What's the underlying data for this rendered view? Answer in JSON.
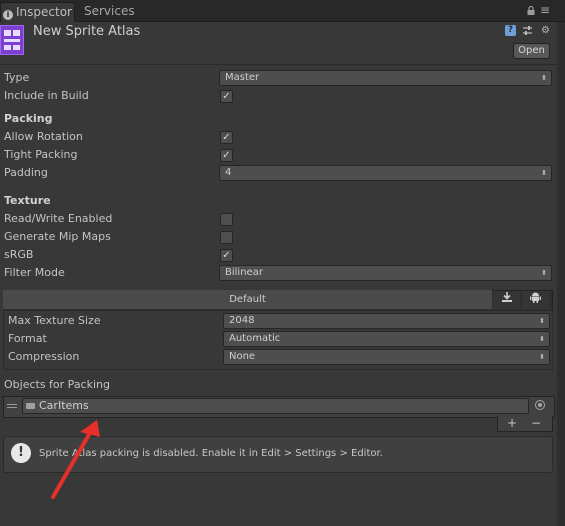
{
  "tabs": [
    {
      "label": "Inspector",
      "active": true
    },
    {
      "label": "Services",
      "active": false
    }
  ],
  "header": {
    "title": "New Sprite Atlas",
    "open_button": "Open"
  },
  "fields": {
    "type_label": "Type",
    "type_value": "Master",
    "include_label": "Include in Build",
    "include_checked": "✓"
  },
  "packing": {
    "title": "Packing",
    "allow_rotation_label": "Allow Rotation",
    "allow_rotation_checked": "✓",
    "tight_packing_label": "Tight Packing",
    "tight_packing_checked": "✓",
    "padding_label": "Padding",
    "padding_value": "4"
  },
  "texture": {
    "title": "Texture",
    "readwrite_label": "Read/Write Enabled",
    "mipmaps_label": "Generate Mip Maps",
    "srgb_label": "sRGB",
    "srgb_checked": "✓",
    "filter_label": "Filter Mode",
    "filter_value": "Bilinear"
  },
  "platform": {
    "tab_label": "Default",
    "max_size_label": "Max Texture Size",
    "max_size_value": "2048",
    "format_label": "Format",
    "format_value": "Automatic",
    "compression_label": "Compression",
    "compression_value": "None"
  },
  "objects": {
    "title": "Objects for Packing",
    "items": [
      "CarItems"
    ],
    "add_label": "+",
    "remove_label": "−"
  },
  "help": {
    "message": "Sprite Atlas packing is disabled. Enable it in Edit > Settings > Editor."
  },
  "annotation": {
    "color": "#e8302a"
  }
}
